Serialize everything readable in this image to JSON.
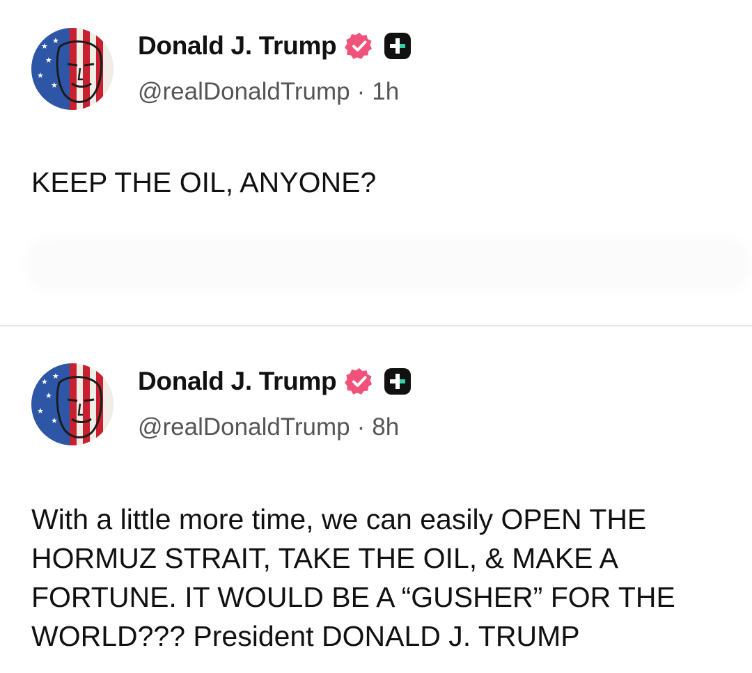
{
  "posts": [
    {
      "author_name": "Donald J. Trump",
      "handle": "@realDonaldTrump",
      "separator": "·",
      "time_ago": "1h",
      "text": "KEEP THE OIL, ANYONE?"
    },
    {
      "author_name": "Donald J. Trump",
      "handle": "@realDonaldTrump",
      "separator": "·",
      "time_ago": "8h",
      "text": "With a little more time, we can easily OPEN THE HORMUZ STRAIT, TAKE THE OIL, & MAKE A FORTUNE. IT WOULD BE A “GUSHER” FOR THE WORLD??? President DONALD J. TRUMP"
    }
  ],
  "colors": {
    "verified_badge": "#f0527a",
    "plus_badge_bg": "#111111",
    "plus_badge_accent": "#2fd1a8",
    "handle_text": "#555555",
    "divider": "#e6e6e6"
  },
  "icons": {
    "verified": "verified-check-badge-icon",
    "plus": "plus-square-badge-icon",
    "avatar": "flag-portrait-avatar"
  }
}
